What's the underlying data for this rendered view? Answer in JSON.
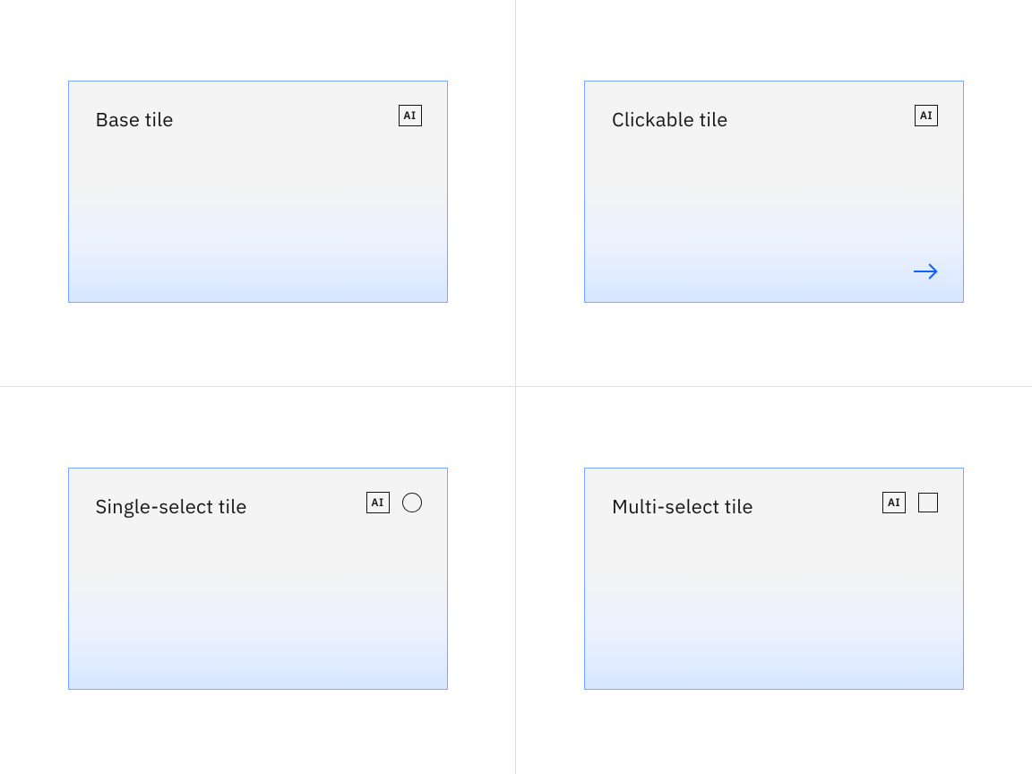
{
  "tiles": {
    "base": {
      "title": "Base tile",
      "badge": "AI"
    },
    "clickable": {
      "title": "Clickable tile",
      "badge": "AI"
    },
    "single_select": {
      "title": "Single-select tile",
      "badge": "AI"
    },
    "multi_select": {
      "title": "Multi-select tile",
      "badge": "AI"
    }
  }
}
